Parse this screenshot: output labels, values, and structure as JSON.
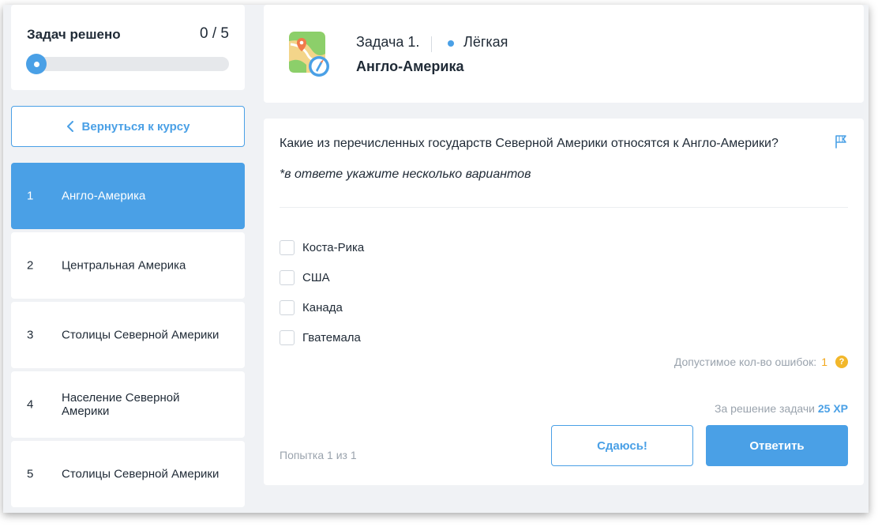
{
  "sidebar": {
    "progress_title": "Задач решено",
    "progress_count": "0 / 5",
    "progress_fraction": 0,
    "back_label": "Вернуться к курсу",
    "tasks": [
      {
        "num": "1",
        "name": "Англо-Америка"
      },
      {
        "num": "2",
        "name": "Центральная Америка"
      },
      {
        "num": "3",
        "name": "Столицы Северной Америки"
      },
      {
        "num": "4",
        "name": "Население Северной Америки"
      },
      {
        "num": "5",
        "name": "Столицы Северной Америки"
      }
    ]
  },
  "header": {
    "task_label": "Задача 1.",
    "difficulty": "Лёгкая",
    "title": "Англо-Америка"
  },
  "question": {
    "text": "Какие из перечисленных государств Северной Америки относятся к Англо-Америки?",
    "hint": "*в ответе укажите несколько вариантов",
    "options": [
      "Коста-Рика",
      "США",
      "Канада",
      "Гватемала"
    ],
    "errors_label": "Допустимое кол-во ошибок:",
    "errors_value": "1",
    "xp_label": "За решение задачи",
    "xp_value": "25 XP",
    "attempt": "Попытка 1 из 1",
    "giveup_label": "Сдаюсь!",
    "answer_label": "Ответить"
  },
  "colors": {
    "accent": "#4aa0e6",
    "warning": "#f2b72a",
    "muted_text": "#9aa3ad",
    "background": "#f0f2f5"
  },
  "icons": [
    "chevron-left-icon",
    "map-compass-icon",
    "flag-icon",
    "help-icon"
  ]
}
